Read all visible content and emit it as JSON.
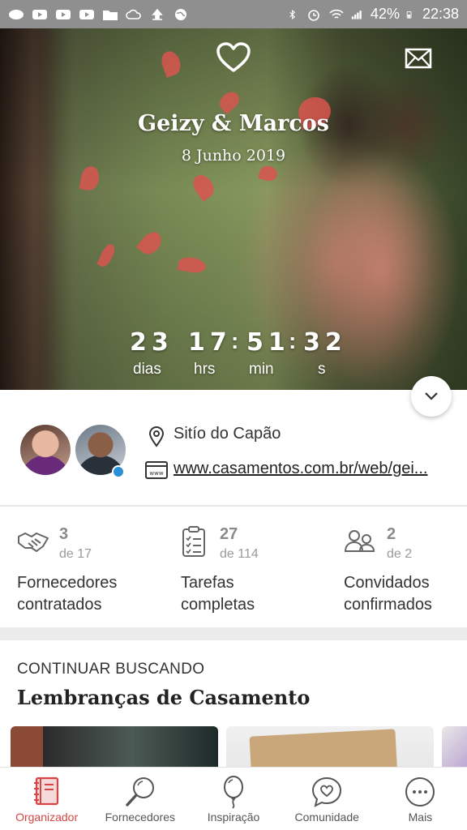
{
  "status_bar": {
    "battery": "42%",
    "time": "22:38"
  },
  "hero": {
    "couple_names": "Geizy & Marcos",
    "wedding_date": "8 Junho 2019",
    "countdown": {
      "days": "23",
      "hours": "17",
      "minutes": "51",
      "seconds": "32",
      "days_label": "dias",
      "hours_label": "hrs",
      "minutes_label": "min",
      "seconds_label": "s"
    }
  },
  "info": {
    "location": "Sitío do Capão",
    "website": "www.casamentos.com.br/web/gei..."
  },
  "stats": [
    {
      "number": "3",
      "of": "de 17",
      "label_line1": "Fornecedores",
      "label_line2": "contratados"
    },
    {
      "number": "27",
      "of": "de 114",
      "label_line1": "Tarefas",
      "label_line2": "completas"
    },
    {
      "number": "2",
      "of": "de 2",
      "label_line1": "Convidados",
      "label_line2": "confirmados"
    }
  ],
  "continue": {
    "title": "CONTINUAR BUSCANDO",
    "subtitle": "Lembranças de Casamento"
  },
  "bottom_nav": [
    {
      "label": "Organizador",
      "active": true
    },
    {
      "label": "Fornecedores",
      "active": false
    },
    {
      "label": "Inspiração",
      "active": false
    },
    {
      "label": "Comunidade",
      "active": false
    },
    {
      "label": "Mais",
      "active": false
    }
  ],
  "colors": {
    "accent": "#d64545",
    "status_bar_bg": "#8f8f8f"
  },
  "icons": {
    "hero": [
      "heart-icon",
      "mail-icon",
      "chevron-down-icon"
    ],
    "info": [
      "location-pin-icon",
      "website-icon"
    ],
    "stats": [
      "handshake-icon",
      "clipboard-icon",
      "guests-icon"
    ],
    "nav": [
      "planner-icon",
      "search-icon",
      "balloon-icon",
      "chat-heart-icon",
      "more-icon"
    ]
  }
}
